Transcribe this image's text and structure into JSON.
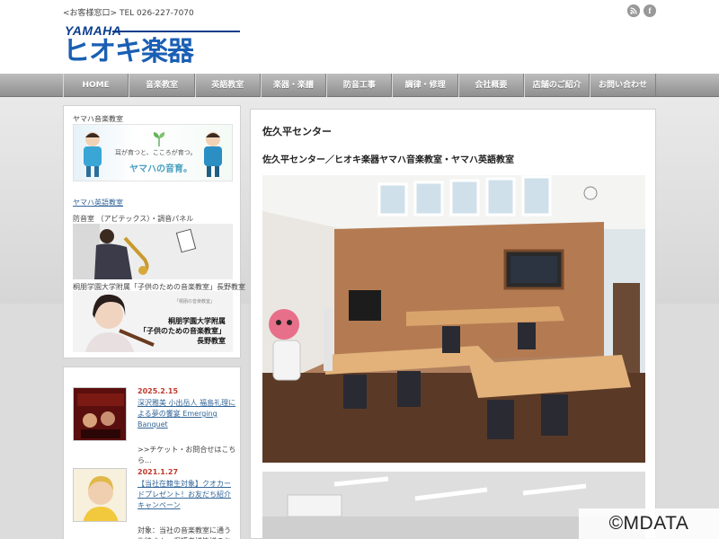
{
  "header": {
    "contact": "<お客様窓口> TEL 026-227-7070",
    "logo_brand": "YAMAHA",
    "logo_name": "ヒオキ楽器",
    "social": {
      "rss_icon": "rss-icon",
      "facebook_icon": "facebook-icon",
      "facebook_glyph": "f"
    }
  },
  "nav": {
    "items": [
      "HOME",
      "音楽教室",
      "英語教室",
      "楽器・楽譜",
      "防音工事",
      "調律・修理",
      "会社概要",
      "店舗のご紹介",
      "お問い合わせ"
    ]
  },
  "sidebar": {
    "music_label": "ヤマハ音楽教室",
    "music_banner": {
      "tagline": "耳が育つと、こころが育つ。",
      "brand": "ヤマハの音育。"
    },
    "english_link": "ヤマハ英語教室",
    "soundproof_label": "防音室 （アビテックス）・調音パネル",
    "school_label": "桐朋学園大学附属「子供のための音楽教室」長野教室",
    "school_banner": {
      "small": "「桐朋の音楽教室」",
      "line1": "桐朋学園大学附属",
      "line2": "「子供のための音楽教室」",
      "line3": "長野教室"
    },
    "news": [
      {
        "date": "2025.2.15",
        "title": "深沢雅美 小出岳人 福島礼理による夢の饗宴 Emerging Banquet",
        "desc": ">>チケット・お問合せはこちら..."
      },
      {
        "date": "2021.1.27",
        "title": "【当社在籍生対象】クオカードプレゼント！お友だち紹介キャンペーン",
        "desc": "対象：当社の音楽教室に通う生徒さん・保護者様皆様のお"
      }
    ]
  },
  "main": {
    "title": "佐久平センター",
    "subtitle": "佐久平センター／ヒオキ楽器ヤマハ音楽教室・ヤマハ英語教室"
  },
  "watermark": "©MDATA",
  "colors": {
    "logo_blue": "#1a5fb4",
    "nav_gray": "#9e9e9e",
    "link_blue": "#336699",
    "date_red": "#c0392b"
  }
}
